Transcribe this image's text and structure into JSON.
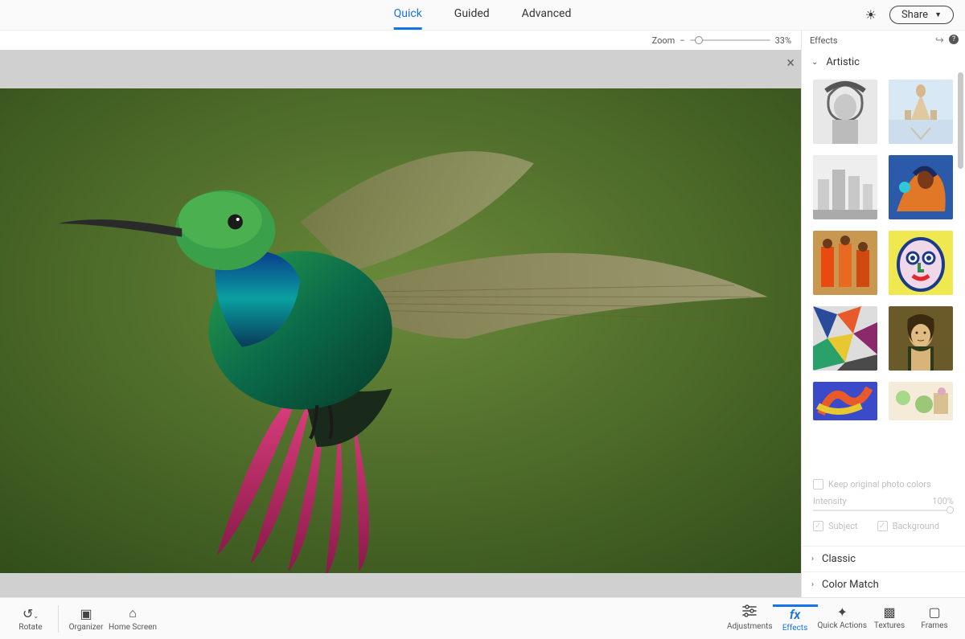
{
  "header": {
    "tabs": [
      "Quick",
      "Guided",
      "Advanced"
    ],
    "active_tab": "Quick",
    "share_label": "Share"
  },
  "zoom": {
    "label": "Zoom",
    "value": "33%"
  },
  "panel": {
    "title": "Effects",
    "sections": {
      "artistic": "Artistic",
      "classic": "Classic",
      "color_match": "Color Match"
    },
    "keep_colors_label": "Keep original photo colors",
    "intensity_label": "Intensity",
    "intensity_value": "100%",
    "subject_label": "Subject",
    "background_label": "Background"
  },
  "bottom": {
    "rotate": "Rotate",
    "organizer": "Organizer",
    "home": "Home Screen",
    "adjustments": "Adjustments",
    "effects": "Effects",
    "quick_actions": "Quick Actions",
    "textures": "Textures",
    "frames": "Frames"
  }
}
